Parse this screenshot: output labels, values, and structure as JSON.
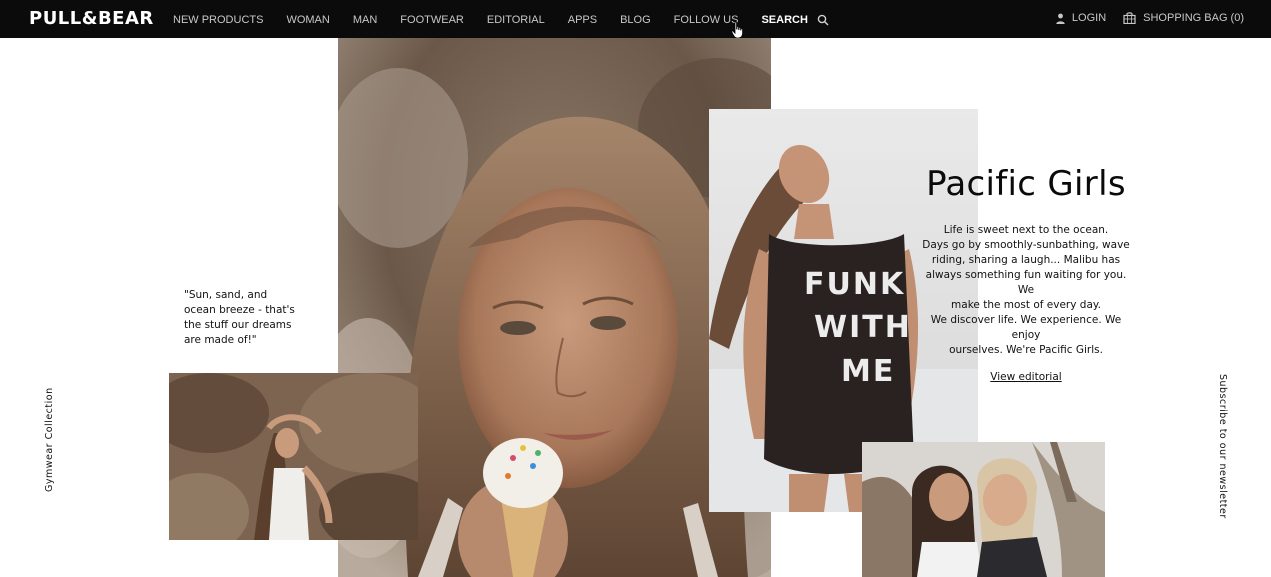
{
  "brand": {
    "logo": "PULL&BEAR"
  },
  "nav": {
    "items": [
      {
        "label": "NEW PRODUCTS"
      },
      {
        "label": "WOMAN"
      },
      {
        "label": "MAN"
      },
      {
        "label": "FOOTWEAR"
      },
      {
        "label": "EDITORIAL"
      },
      {
        "label": "APPS"
      },
      {
        "label": "BLOG"
      },
      {
        "label": "FOLLOW US"
      }
    ],
    "search_label": "SEARCH",
    "login_label": "LOGIN",
    "bag_label": "SHOPPING BAG (0)"
  },
  "quote": {
    "lines": [
      "\"Sun, sand, and",
      "ocean breeze - that's",
      "the stuff our dreams",
      "are made of!\""
    ]
  },
  "editorial": {
    "title": "Pacific Girls",
    "body_lines": [
      "Life is sweet next to the ocean.",
      "Days go by smoothly-sunbathing, wave",
      "riding, sharing a laugh... Malibu has",
      "always something fun waiting for you. We",
      "make the most of every day.",
      "We discover life. We experience. We enjoy",
      "ourselves. We're Pacific Girls."
    ],
    "link_label": "View editorial"
  },
  "side": {
    "left_label": "Gymwear Collection",
    "right_label": "Subscribe to our newsletter"
  },
  "shirt_text": {
    "line1": "FUNK",
    "line2": "WITH",
    "line3": "ME"
  },
  "colors": {
    "nav_bg": "#0b0b0b",
    "nav_text": "#c8c8c8",
    "active_text": "#ffffff",
    "page_bg": "#ffffff"
  },
  "icons": {
    "search": "search-icon",
    "login": "user-icon",
    "bag": "shopping-bag-icon",
    "cursor": "hand-pointer-icon"
  }
}
